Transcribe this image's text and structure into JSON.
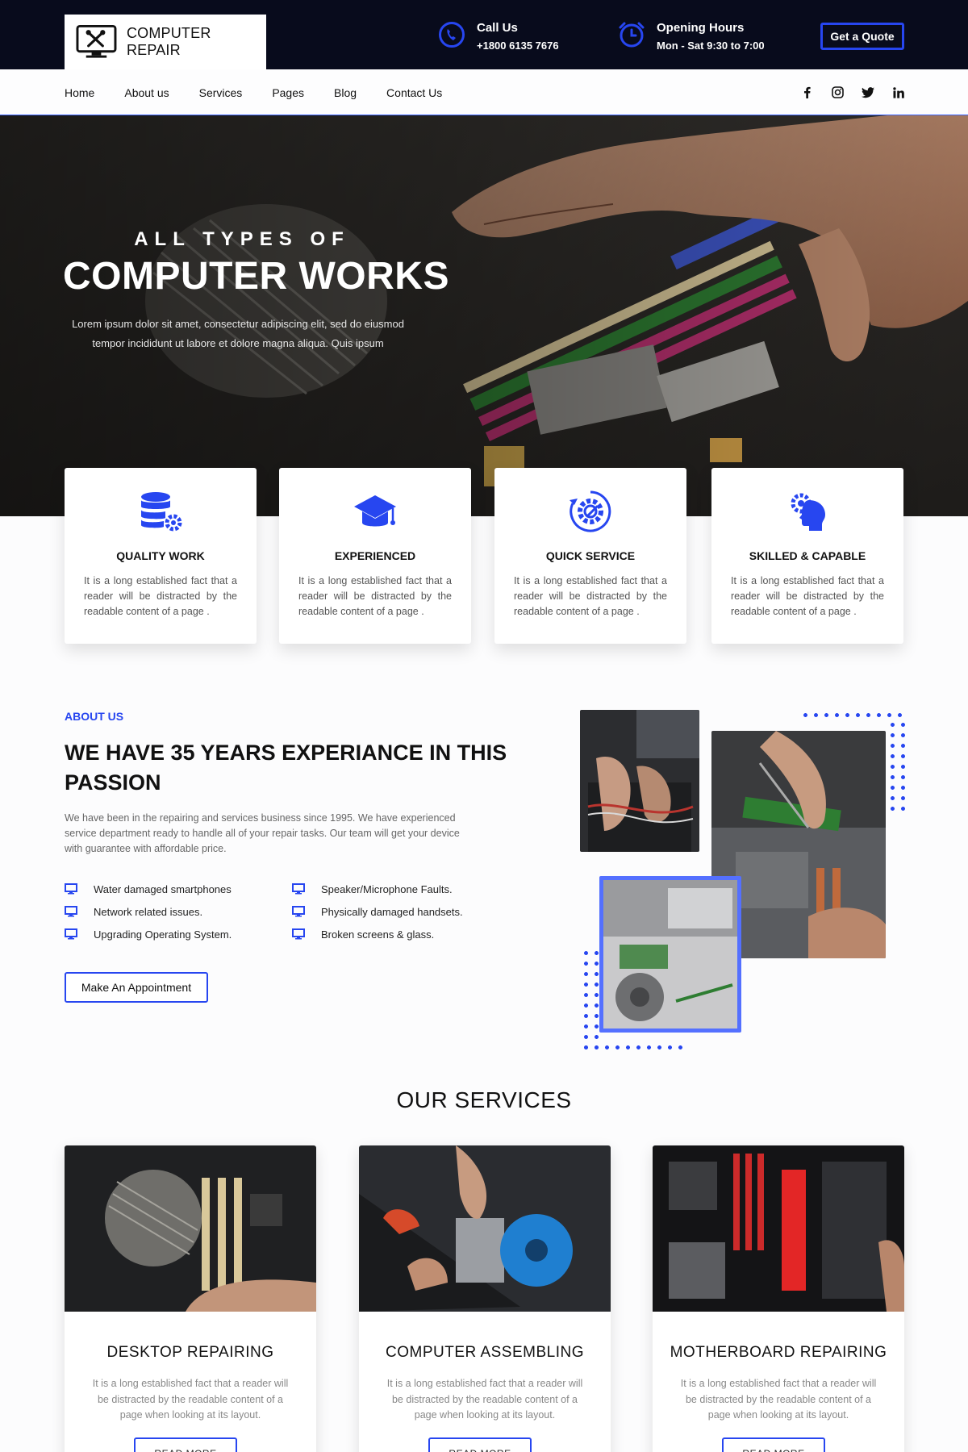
{
  "topbar": {
    "logo_text": "COMPUTER REPAIR",
    "call": {
      "title": "Call Us",
      "value": "+1800 6135 7676"
    },
    "hours": {
      "title": "Opening Hours",
      "value": "Mon - Sat  9:30 to 7:00"
    },
    "quote_label": "Get a Quote"
  },
  "nav": {
    "items": [
      "Home",
      "About us",
      "Services",
      "Pages",
      "Blog",
      "Contact Us"
    ],
    "socials": [
      "facebook-icon",
      "instagram-icon",
      "twitter-icon",
      "linkedin-icon"
    ]
  },
  "hero": {
    "eyebrow": "ALL TYPES OF",
    "title": "COMPUTER WORKS",
    "description": "Lorem ipsum dolor sit amet, consectetur adipiscing elit, sed do eiusmod tempor incididunt ut labore et dolore magna aliqua. Quis ipsum"
  },
  "features": [
    {
      "icon": "database-gear-icon",
      "title": "QUALITY WORK",
      "text": "It is a long established fact that a reader will be distracted by the readable content of a page ."
    },
    {
      "icon": "graduation-cap-icon",
      "title": "EXPERIENCED",
      "text": "It is a long established fact that a reader will be distracted by the readable content of a page ."
    },
    {
      "icon": "gear-refresh-icon",
      "title": "QUICK SERVICE",
      "text": "It is a long established fact that a reader will be distracted by the readable content of a page ."
    },
    {
      "icon": "head-gear-icon",
      "title": "SKILLED & CAPABLE",
      "text": "It is a long established fact that a reader will be distracted by the readable content of a page ."
    }
  ],
  "about": {
    "label": "ABOUT US",
    "title": "WE HAVE 35 YEARS EXPERIANCE IN THIS PASSION",
    "description": "We have been in the repairing and services business since 1995. We have experienced service department ready to handle all of your repair tasks. Our team will get your device with guarantee with affordable price.",
    "list": [
      "Water damaged smartphones",
      "Speaker/Microphone Faults.",
      "Network related issues.",
      "Physically damaged handsets.",
      "Upgrading Operating System.",
      "Broken screens & glass."
    ],
    "button_label": "Make An Appointment"
  },
  "services": {
    "title": "OUR SERVICES",
    "items": [
      {
        "title": "DESKTOP REPAIRING",
        "text": "It is a long established fact that a reader will be distracted by the readable content of a page when looking at its layout.",
        "button": "READ MORE"
      },
      {
        "title": "COMPUTER ASSEMBLING",
        "text": "It is a long established fact that a reader will be distracted by the readable content of a page when looking at its layout.",
        "button": "READ MORE"
      },
      {
        "title": "MOTHERBOARD REPAIRING",
        "text": "It is a long established fact that a reader will be distracted by the readable content of a page when looking at its layout.",
        "button": "READ MORE"
      }
    ]
  },
  "colors": {
    "accent": "#2746f0",
    "topbar": "#080b1c"
  }
}
